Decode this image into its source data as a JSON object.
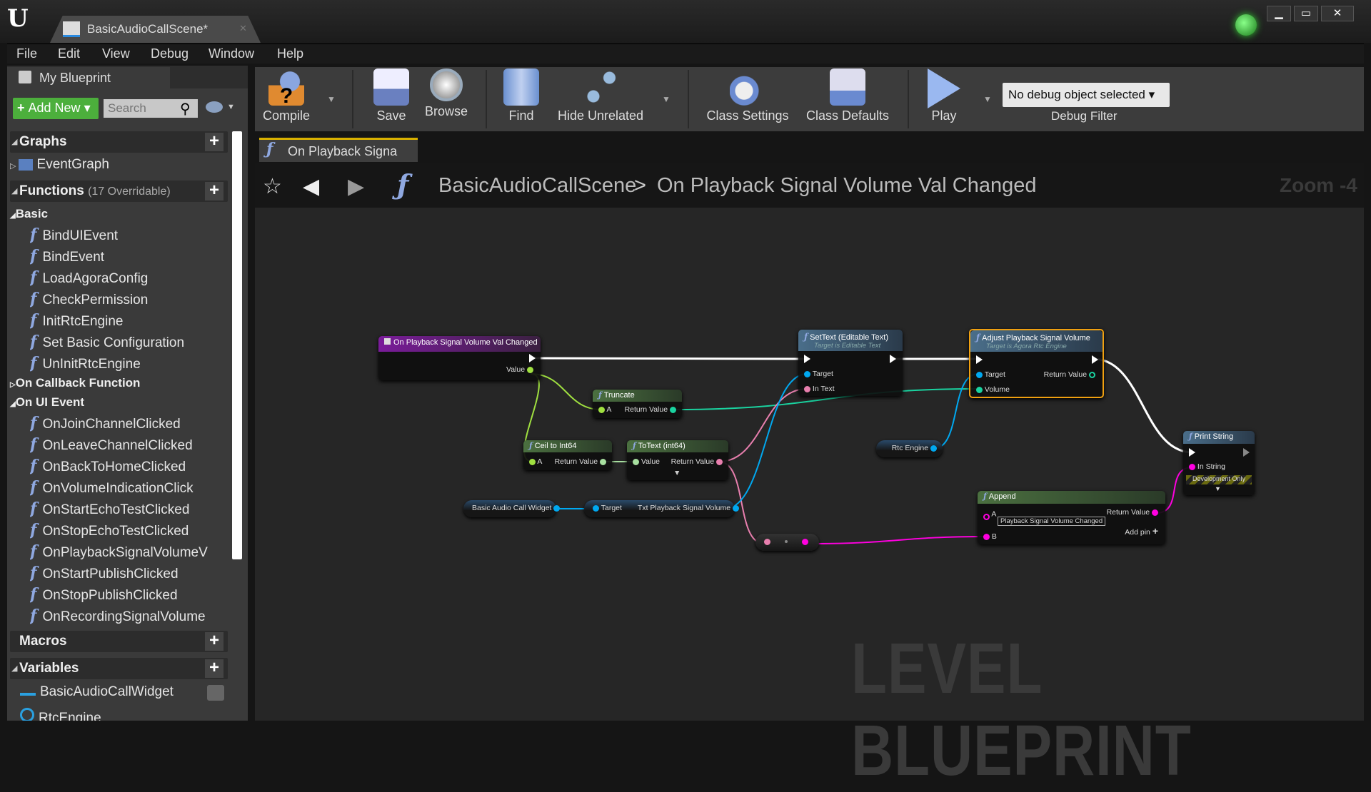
{
  "window": {
    "tab_title": "BasicAudioCallScene*",
    "controls": [
      "minimize",
      "maximize",
      "close"
    ]
  },
  "menu": [
    "File",
    "Edit",
    "View",
    "Debug",
    "Window",
    "Help"
  ],
  "my_blueprint": {
    "tab_label": "My Blueprint",
    "add_new": "Add New",
    "search_placeholder": "Search",
    "graphs": {
      "label": "Graphs",
      "items": [
        "EventGraph"
      ]
    },
    "functions": {
      "label": "Functions",
      "note": "(17 Overridable)",
      "categories": [
        {
          "label": "Basic",
          "items": [
            "BindUIEvent",
            "BindEvent",
            "LoadAgoraConfig",
            "CheckPermission",
            "InitRtcEngine",
            "Set Basic Configuration",
            "UnInitRtcEngine"
          ]
        },
        {
          "label": "On Callback Function",
          "items": []
        },
        {
          "label": "On UI Event",
          "items": [
            "OnJoinChannelClicked",
            "OnLeaveChannelClicked",
            "OnBackToHomeClicked",
            "OnVolumeIndicationClick",
            "OnStartEchoTestClicked",
            "OnStopEchoTestClicked",
            "OnPlaybackSignalVolumeV",
            "OnStartPublishClicked",
            "OnStopPublishClicked",
            "OnRecordingSignalVolume"
          ]
        }
      ]
    },
    "macros": {
      "label": "Macros"
    },
    "variables": {
      "label": "Variables",
      "items": [
        "BasicAudioCallWidget",
        "RtcEngine"
      ]
    }
  },
  "toolbar": {
    "compile": "Compile",
    "save": "Save",
    "browse": "Browse",
    "find": "Find",
    "hide_unrelated": "Hide Unrelated",
    "class_settings": "Class Settings",
    "class_defaults": "Class Defaults",
    "play": "Play",
    "debug_object": "No debug object selected",
    "debug_filter": "Debug Filter"
  },
  "graph": {
    "tab_label": "On Playback Signa",
    "breadcrumb": [
      "BasicAudioCallScene",
      "On Playback Signal Volume Val Changed"
    ],
    "breadcrumb_sep": ">",
    "zoom": "Zoom -4",
    "watermark": "LEVEL BLUEPRINT",
    "nodes": {
      "event": {
        "title": "On Playback Signal Volume Val Changed",
        "value": "Value"
      },
      "settext": {
        "title": "SetText (Editable Text)",
        "subtitle": "Target is Editable Text",
        "target": "Target",
        "in_text": "In Text"
      },
      "adjust": {
        "title": "Adjust Playback Signal Volume",
        "subtitle": "Target is Agora Rtc Engine",
        "target": "Target",
        "volume": "Volume",
        "return": "Return Value"
      },
      "truncate": {
        "title": "Truncate",
        "a": "A",
        "return": "Return Value"
      },
      "ceil": {
        "title": "Ceil to Int64",
        "a": "A",
        "return": "Return Value"
      },
      "totext": {
        "title": "ToText (int64)",
        "value": "Value",
        "return": "Return Value"
      },
      "widget_var": {
        "label": "Basic Audio Call Widget"
      },
      "txt_get": {
        "target": "Target",
        "label": "Txt Playback Signal Volume"
      },
      "rtc_var": {
        "label": "Rtc Engine"
      },
      "append": {
        "title": "Append",
        "a": "A",
        "a_value": "Playback Signal Volume Changed",
        "b": "B",
        "return": "Return Value",
        "add_pin": "Add pin"
      },
      "print": {
        "title": "Print String",
        "in_string": "In String",
        "dev_only": "Development Only"
      }
    },
    "colors": {
      "exec": "#ffffff",
      "float": "#a0e040",
      "int64": "#a8e0a0",
      "text": "#e87fae",
      "object": "#00a8f0",
      "string": "#ff00e0",
      "volume": "#1ad3a0",
      "selected": "#f0a010"
    }
  }
}
